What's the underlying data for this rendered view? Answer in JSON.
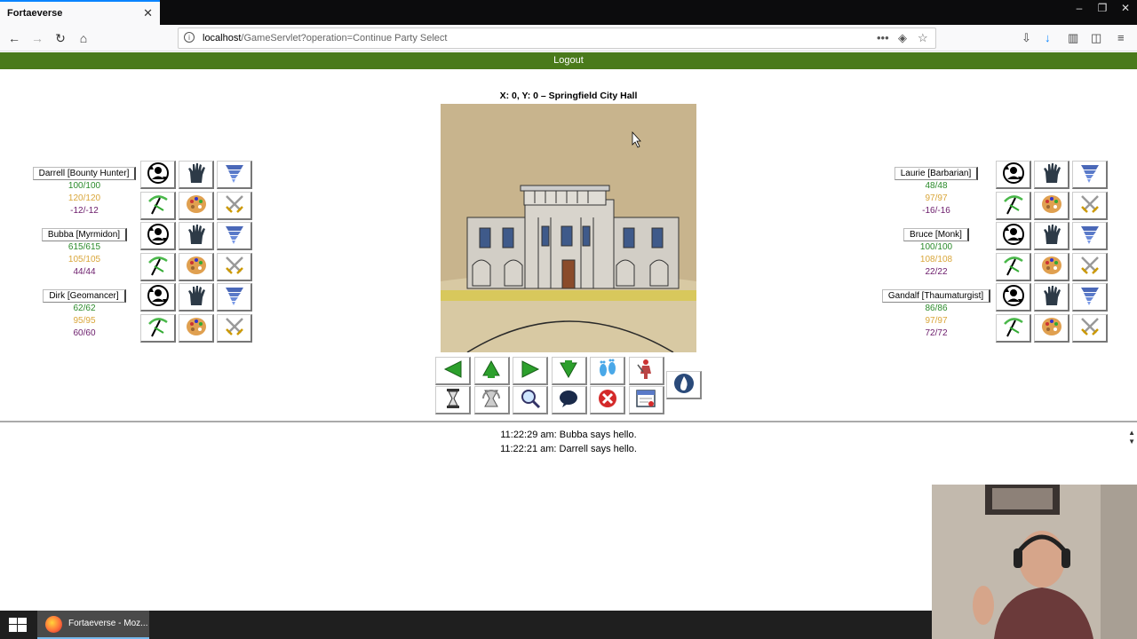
{
  "browser": {
    "tab_title": "Fortaeverse",
    "url_host": "localhost",
    "url_path": "/GameServlet?operation=Continue Party Select"
  },
  "header": {
    "logout_label": "Logout"
  },
  "location": {
    "label": "X: 0, Y: 0 – Springfield City Hall"
  },
  "party_left": [
    {
      "name": "Darrell [Bounty Hunter]",
      "hp": "100/100",
      "sp": "120/120",
      "xp": "-12/-12"
    },
    {
      "name": "Bubba [Myrmidon]",
      "hp": "615/615",
      "sp": "105/105",
      "xp": "44/44"
    },
    {
      "name": "Dirk [Geomancer]",
      "hp": "62/62",
      "sp": "95/95",
      "xp": "60/60"
    }
  ],
  "party_right": [
    {
      "name": "Laurie [Barbarian]",
      "hp": "48/48",
      "sp": "97/97",
      "xp": "-16/-16"
    },
    {
      "name": "Bruce [Monk]",
      "hp": "100/100",
      "sp": "108/108",
      "xp": "22/22"
    },
    {
      "name": "Gandalf [Thaumaturgist]",
      "hp": "86/86",
      "sp": "97/97",
      "xp": "72/72"
    }
  ],
  "member_action_icons": [
    "swap-character-icon",
    "glove-icon",
    "tornado-icon",
    "pickaxe-icon",
    "palette-icon",
    "crossed-swords-icon"
  ],
  "controls": {
    "row1": [
      "arrow-left-icon",
      "arrow-up-icon",
      "arrow-right-icon",
      "arrow-down-icon",
      "footprints-icon",
      "fighter-icon"
    ],
    "row2": [
      "hourglass-icon",
      "rest-icon",
      "magnifier-icon",
      "speech-icon",
      "cancel-icon",
      "calendar-icon"
    ],
    "extra": "flame-icon"
  },
  "messages": [
    "11:22:29 am: Bubba says hello.",
    "11:22:21 am: Darrell says hello."
  ],
  "taskbar": {
    "app_label": "Fortaeverse - Moz..."
  },
  "colors": {
    "header_green": "#4a7a1b",
    "hp": "#2a8a2a",
    "sp": "#d9a63a",
    "xp": "#6a1a6a"
  }
}
